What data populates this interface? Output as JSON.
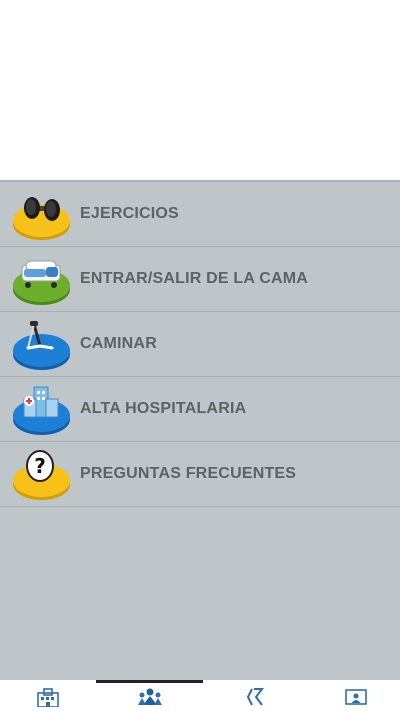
{
  "menu": {
    "items": [
      {
        "label": "EJERCICIOS",
        "icon": "dumbbell-icon",
        "disc_color": "#f6c21a"
      },
      {
        "label": "ENTRAR/SALIR DE LA CAMA",
        "icon": "hospital-bed-icon",
        "disc_color": "#6dae2c"
      },
      {
        "label": "CAMINAR",
        "icon": "walker-icon",
        "disc_color": "#1e7fd6"
      },
      {
        "label": "ALTA HOSPITALARIA",
        "icon": "hospital-building-icon",
        "disc_color": "#1e7fd6"
      },
      {
        "label": "PREGUNTAS FRECUENTES",
        "icon": "question-mark-icon",
        "disc_color": "#f6c21a"
      }
    ]
  },
  "bottom_nav": {
    "items": [
      {
        "icon": "hospital-icon"
      },
      {
        "icon": "team-icon"
      },
      {
        "icon": "logo-icon"
      },
      {
        "icon": "doctor-screen-icon"
      }
    ]
  }
}
